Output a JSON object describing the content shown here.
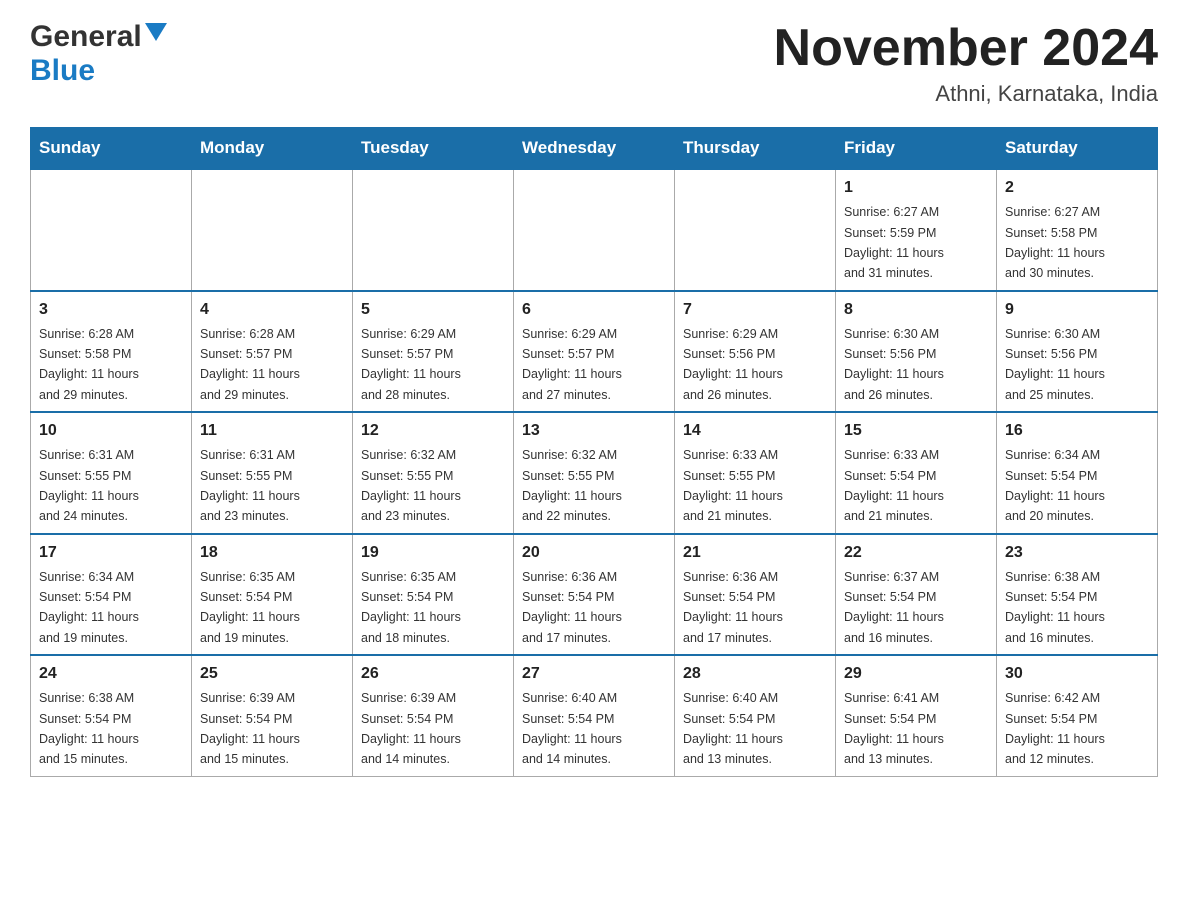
{
  "logo": {
    "general": "General",
    "blue": "Blue"
  },
  "title": "November 2024",
  "location": "Athni, Karnataka, India",
  "weekdays": [
    "Sunday",
    "Monday",
    "Tuesday",
    "Wednesday",
    "Thursday",
    "Friday",
    "Saturday"
  ],
  "weeks": [
    [
      {
        "day": "",
        "info": ""
      },
      {
        "day": "",
        "info": ""
      },
      {
        "day": "",
        "info": ""
      },
      {
        "day": "",
        "info": ""
      },
      {
        "day": "",
        "info": ""
      },
      {
        "day": "1",
        "info": "Sunrise: 6:27 AM\nSunset: 5:59 PM\nDaylight: 11 hours\nand 31 minutes."
      },
      {
        "day": "2",
        "info": "Sunrise: 6:27 AM\nSunset: 5:58 PM\nDaylight: 11 hours\nand 30 minutes."
      }
    ],
    [
      {
        "day": "3",
        "info": "Sunrise: 6:28 AM\nSunset: 5:58 PM\nDaylight: 11 hours\nand 29 minutes."
      },
      {
        "day": "4",
        "info": "Sunrise: 6:28 AM\nSunset: 5:57 PM\nDaylight: 11 hours\nand 29 minutes."
      },
      {
        "day": "5",
        "info": "Sunrise: 6:29 AM\nSunset: 5:57 PM\nDaylight: 11 hours\nand 28 minutes."
      },
      {
        "day": "6",
        "info": "Sunrise: 6:29 AM\nSunset: 5:57 PM\nDaylight: 11 hours\nand 27 minutes."
      },
      {
        "day": "7",
        "info": "Sunrise: 6:29 AM\nSunset: 5:56 PM\nDaylight: 11 hours\nand 26 minutes."
      },
      {
        "day": "8",
        "info": "Sunrise: 6:30 AM\nSunset: 5:56 PM\nDaylight: 11 hours\nand 26 minutes."
      },
      {
        "day": "9",
        "info": "Sunrise: 6:30 AM\nSunset: 5:56 PM\nDaylight: 11 hours\nand 25 minutes."
      }
    ],
    [
      {
        "day": "10",
        "info": "Sunrise: 6:31 AM\nSunset: 5:55 PM\nDaylight: 11 hours\nand 24 minutes."
      },
      {
        "day": "11",
        "info": "Sunrise: 6:31 AM\nSunset: 5:55 PM\nDaylight: 11 hours\nand 23 minutes."
      },
      {
        "day": "12",
        "info": "Sunrise: 6:32 AM\nSunset: 5:55 PM\nDaylight: 11 hours\nand 23 minutes."
      },
      {
        "day": "13",
        "info": "Sunrise: 6:32 AM\nSunset: 5:55 PM\nDaylight: 11 hours\nand 22 minutes."
      },
      {
        "day": "14",
        "info": "Sunrise: 6:33 AM\nSunset: 5:55 PM\nDaylight: 11 hours\nand 21 minutes."
      },
      {
        "day": "15",
        "info": "Sunrise: 6:33 AM\nSunset: 5:54 PM\nDaylight: 11 hours\nand 21 minutes."
      },
      {
        "day": "16",
        "info": "Sunrise: 6:34 AM\nSunset: 5:54 PM\nDaylight: 11 hours\nand 20 minutes."
      }
    ],
    [
      {
        "day": "17",
        "info": "Sunrise: 6:34 AM\nSunset: 5:54 PM\nDaylight: 11 hours\nand 19 minutes."
      },
      {
        "day": "18",
        "info": "Sunrise: 6:35 AM\nSunset: 5:54 PM\nDaylight: 11 hours\nand 19 minutes."
      },
      {
        "day": "19",
        "info": "Sunrise: 6:35 AM\nSunset: 5:54 PM\nDaylight: 11 hours\nand 18 minutes."
      },
      {
        "day": "20",
        "info": "Sunrise: 6:36 AM\nSunset: 5:54 PM\nDaylight: 11 hours\nand 17 minutes."
      },
      {
        "day": "21",
        "info": "Sunrise: 6:36 AM\nSunset: 5:54 PM\nDaylight: 11 hours\nand 17 minutes."
      },
      {
        "day": "22",
        "info": "Sunrise: 6:37 AM\nSunset: 5:54 PM\nDaylight: 11 hours\nand 16 minutes."
      },
      {
        "day": "23",
        "info": "Sunrise: 6:38 AM\nSunset: 5:54 PM\nDaylight: 11 hours\nand 16 minutes."
      }
    ],
    [
      {
        "day": "24",
        "info": "Sunrise: 6:38 AM\nSunset: 5:54 PM\nDaylight: 11 hours\nand 15 minutes."
      },
      {
        "day": "25",
        "info": "Sunrise: 6:39 AM\nSunset: 5:54 PM\nDaylight: 11 hours\nand 15 minutes."
      },
      {
        "day": "26",
        "info": "Sunrise: 6:39 AM\nSunset: 5:54 PM\nDaylight: 11 hours\nand 14 minutes."
      },
      {
        "day": "27",
        "info": "Sunrise: 6:40 AM\nSunset: 5:54 PM\nDaylight: 11 hours\nand 14 minutes."
      },
      {
        "day": "28",
        "info": "Sunrise: 6:40 AM\nSunset: 5:54 PM\nDaylight: 11 hours\nand 13 minutes."
      },
      {
        "day": "29",
        "info": "Sunrise: 6:41 AM\nSunset: 5:54 PM\nDaylight: 11 hours\nand 13 minutes."
      },
      {
        "day": "30",
        "info": "Sunrise: 6:42 AM\nSunset: 5:54 PM\nDaylight: 11 hours\nand 12 minutes."
      }
    ]
  ]
}
